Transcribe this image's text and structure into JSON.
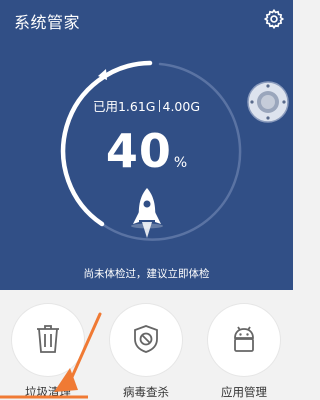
{
  "header": {
    "title": "系统管家",
    "settings_icon": "gear-icon"
  },
  "memory": {
    "used": "已用1.61G",
    "total": "4.00G",
    "percent": "40",
    "percent_unit": "%",
    "used_fraction": 0.4
  },
  "status": {
    "tip": "尚未体检过，建议立即体检"
  },
  "float_ball": {
    "icon": "float-ball-icon"
  },
  "features": [
    {
      "label": "垃圾清理",
      "icon": "trash-icon"
    },
    {
      "label": "病毒查杀",
      "icon": "virus-block-icon"
    },
    {
      "label": "应用管理",
      "icon": "android-icon"
    }
  ],
  "colors": {
    "primary": "#314f86",
    "accent": "#f07a34",
    "background": "#f2f2f2"
  }
}
